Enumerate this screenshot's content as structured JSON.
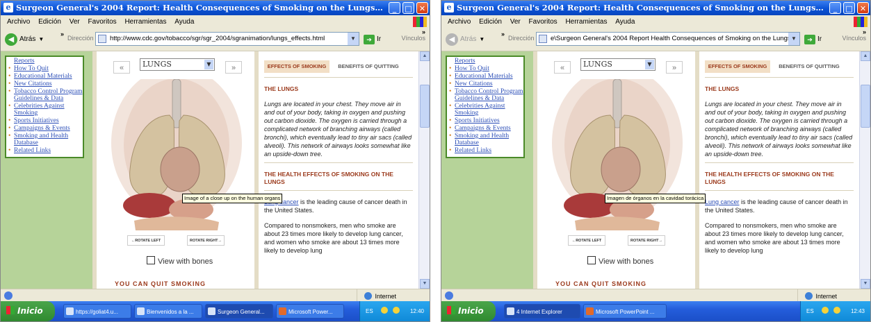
{
  "colors": {
    "title_bar": "#0a52d6",
    "sidebar_bg": "#b6d399",
    "heading": "#9b3a1c",
    "link": "#2a4db7",
    "taskbar": "#245ddb",
    "start": "#3a9a3a"
  },
  "panels": [
    {
      "window_title": "Surgeon General's 2004 Report: Health Consequences of Smoking on the Lungs - Effects - Microsoft Internet Exp...",
      "menu": [
        "Archivo",
        "Edición",
        "Ver",
        "Favoritos",
        "Herramientas",
        "Ayuda"
      ],
      "toolbar": {
        "back_label": "Atrás",
        "back_icon": "back-arrow-icon",
        "address_label": "Dirección",
        "address": "http://www.cdc.gov/tobacco/sgr/sgr_2004/sgranimation/lungs_effects.html",
        "go_label": "Ir",
        "links_label": "Vínculos",
        "chevron": "»"
      },
      "sidebar_items": [
        "Reports",
        "How To Quit",
        "Educational Materials",
        "New Citations",
        "Tobacco Control Program Guidelines & Data",
        "Celebrities Against Smoking",
        "Sports Initiatives",
        "Campaigns & Events",
        "Smoking and Health Database",
        "Related Links"
      ],
      "organ_select": "LUNGS",
      "nav_prev": "«",
      "nav_next": "»",
      "tooltip": "Image of a close up on the human organs",
      "rotate_left": "←ROTATE LEFT",
      "rotate_right": "ROTATE RIGHT→",
      "view_bones": "View with bones",
      "promo": "YOU CAN QUIT SMOKING",
      "tab_effects": "EFFECTS OF SMOKING",
      "tab_benefits": "BENEFITS OF QUITTING",
      "heading1": "THE LUNGS",
      "para1": "Lungs are located in your chest. They move air in and out of your body, taking in oxygen and pushing out carbon dioxide. The oxygen is carried through a complicated network of branching airways (called bronchi), which eventually lead to tiny air sacs (called alveoli). This network of airways looks somewhat like an upside-down tree.",
      "heading2": "THE HEALTH EFFECTS OF SMOKING ON THE LUNGS",
      "para2_link": "Lung cancer",
      "para2_rest": " is the leading cause of cancer death in the United States.",
      "para3": "Compared to nonsmokers, men who smoke are about 23 times more likely to develop lung cancer, and women who smoke are about 13 times more likely to develop lung",
      "status_zone": "Internet",
      "taskbar": {
        "start": "Inicio",
        "buttons": [
          "https://goliat4.u...",
          "Bienvenidos a la ...",
          "Surgeon General...",
          "Microsoft Power..."
        ],
        "lang": "ES",
        "time": "12:40"
      }
    },
    {
      "window_title": "Surgeon General's 2004 Report: Health Consequences of Smoking on the Lungs - Effects - Microsoft Internet Exp...",
      "menu": [
        "Archivo",
        "Edición",
        "Ver",
        "Favoritos",
        "Herramientas",
        "Ayuda"
      ],
      "toolbar": {
        "back_label": "Atrás",
        "back_icon": "back-arrow-icon",
        "address_label": "Dirección",
        "address": "e\\Surgeon General's 2004 Report Health Consequences of Smoking on the Lungs - Effects.htm",
        "go_label": "Ir",
        "links_label": "Vínculos",
        "chevron": "»"
      },
      "sidebar_items": [
        "Reports",
        "How To Quit",
        "Educational Materials",
        "New Citations",
        "Tobacco Control Program Guidelines & Data",
        "Celebrities Against Smoking",
        "Sports Initiatives",
        "Campaigns & Events",
        "Smoking and Health Database",
        "Related Links"
      ],
      "organ_select": "LUNGS",
      "nav_prev": "«",
      "nav_next": "»",
      "tooltip": "Imagen de órganos en la cavidad torácica",
      "rotate_left": "←ROTATE LEFT",
      "rotate_right": "ROTATE RIGHT→",
      "view_bones": "View with bones",
      "promo": "YOU CAN QUIT SMOKING",
      "tab_effects": "EFFECTS OF SMOKING",
      "tab_benefits": "BENEFITS OF QUITTING",
      "heading1": "THE LUNGS",
      "para1": "Lungs are located in your chest. They move air in and out of your body, taking in oxygen and pushing out carbon dioxide. The oxygen is carried through a complicated network of branching airways (called bronchi), which eventually lead to tiny air sacs (called alveoli). This network of airways looks somewhat like an upside-down tree.",
      "heading2": "THE HEALTH EFFECTS OF SMOKING ON THE LUNGS",
      "para2_link": "Lung cancer",
      "para2_rest": " is the leading cause of cancer death in the United States.",
      "para3": "Compared to nonsmokers, men who smoke are about 23 times more likely to develop lung cancer, and women who smoke are about 13 times more likely to develop lung",
      "status_zone": "Internet",
      "taskbar": {
        "start": "Inicio",
        "buttons": [
          "4 Internet Explorer",
          "Microsoft PowerPoint ..."
        ],
        "lang": "ES",
        "time": "12:43"
      }
    }
  ]
}
